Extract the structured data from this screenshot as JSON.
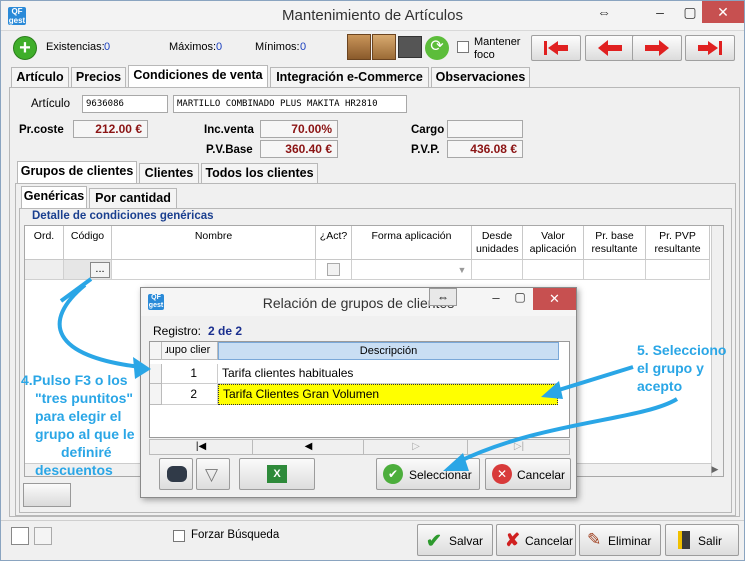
{
  "window": {
    "title": "Mantenimiento de Artículos",
    "logo_text": "QF gest"
  },
  "toolbar": {
    "existencias_label": "Existencias:",
    "existencias_value": "0",
    "maximos_label": "Máximos:",
    "maximos_value": "0",
    "minimos_label": "Mínimos:",
    "minimos_value": "0",
    "mantener_foco_line1": "Mantener",
    "mantener_foco_line2": "foco"
  },
  "main_tabs": [
    {
      "label": "Artículo"
    },
    {
      "label": "Precios"
    },
    {
      "label": "Condiciones de venta"
    },
    {
      "label": "Integración e-Commerce"
    },
    {
      "label": "Observaciones"
    }
  ],
  "article": {
    "label": "Artículo",
    "code": "9636086",
    "description": "MARTILLO COMBINADO PLUS MAKITA HR2810"
  },
  "prices": {
    "prcoste_label": "Pr.coste",
    "prcoste_value": "212.00 €",
    "incventa_label": "Inc.venta",
    "incventa_value": "70.00%",
    "pvbase_label": "P.V.Base",
    "pvbase_value": "360.40 €",
    "cargo_label": "Cargo",
    "cargo_value": "",
    "pvp_label": "P.V.P.",
    "pvp_value": "436.08 €"
  },
  "sub_tabs": [
    {
      "label": "Grupos de clientes"
    },
    {
      "label": "Clientes"
    },
    {
      "label": "Todos los clientes"
    }
  ],
  "inner_tabs": [
    {
      "label": "Genéricas"
    },
    {
      "label": "Por cantidad"
    }
  ],
  "detail": {
    "title": "Detalle de condiciones genéricas",
    "columns": [
      "Ord.",
      "Código",
      "Nombre",
      "¿Act?",
      "Forma aplicación",
      "Desde unidades",
      "Valor aplicación",
      "Pr. base resultante",
      "Pr. PVP resultante"
    ],
    "ellipsis_button": "..."
  },
  "dialog": {
    "title": "Relación de grupos de clientes",
    "registro_label": "Registro:",
    "registro_value": "2 de 2",
    "col_group": "ɹupo clier",
    "col_desc": "Descripción",
    "rows": [
      {
        "code": "1",
        "desc": "Tarifa clientes habituales"
      },
      {
        "code": "2",
        "desc": "Tarifa Clientes Gran Volumen"
      }
    ],
    "select_button": "Seleccionar",
    "cancel_button": "Cancelar"
  },
  "bottom": {
    "forzar_busqueda": "Forzar Búsqueda",
    "salvar": "Salvar",
    "cancelar": "Cancelar",
    "eliminar": "Eliminar",
    "salir": "Salir"
  },
  "annotations": {
    "step4": [
      "4.Pulso F3 o los",
      "\"tres puntitos\"",
      "para elegir el",
      "grupo al que le",
      "definiré",
      "descuentos"
    ],
    "step5": [
      "5. Selecciono",
      "el grupo y",
      "acepto"
    ]
  },
  "colors": {
    "price_text": "#8b1414",
    "value_blue": "#1a3fbf",
    "annotation": "#2aa6e6",
    "selected_row": "#ffff00",
    "header_blue": "#c9def3"
  }
}
